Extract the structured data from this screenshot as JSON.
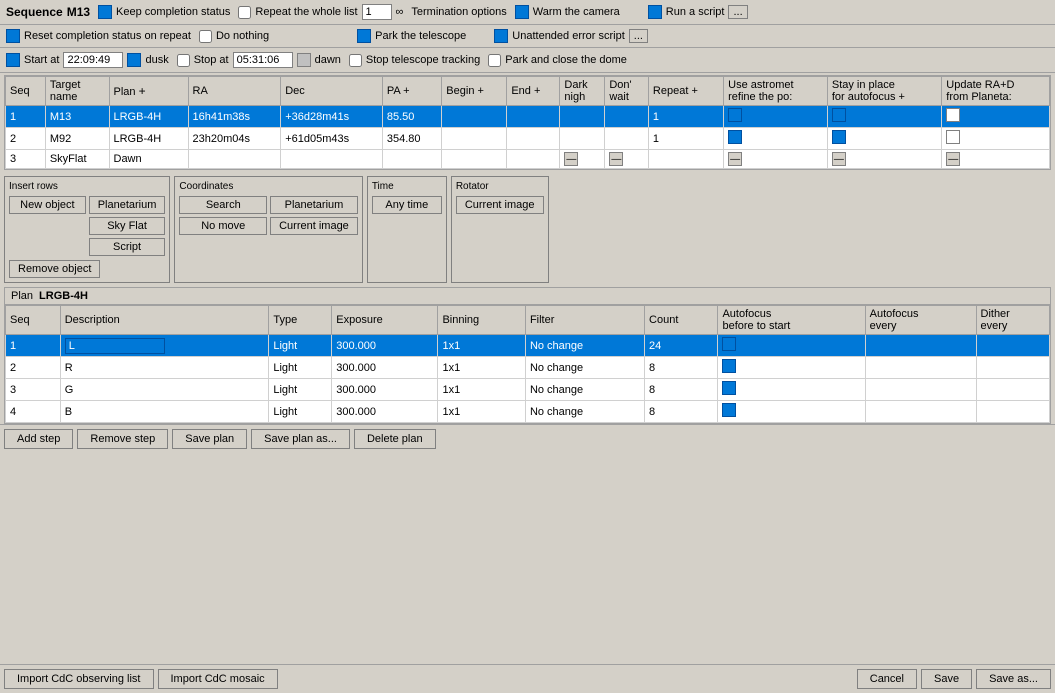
{
  "sequence": {
    "label": "Sequence",
    "name": "M13",
    "repeat_label": "Repeat the whole list",
    "repeat_value": "1",
    "keep_completion_label": "Keep completion status",
    "reset_completion_label": "Reset completion status on repeat",
    "start_at_label": "Start at",
    "start_time": "22:09:49",
    "dusk_label": "dusk",
    "stop_at_label": "Stop at",
    "stop_time": "05:31:06",
    "dawn_label": "dawn"
  },
  "termination": {
    "label": "Termination options",
    "do_nothing": "Do nothing",
    "stop_tracking": "Stop telescope tracking",
    "warm_camera": "Warm the camera",
    "park_telescope": "Park the telescope",
    "park_close_dome": "Park and close the dome",
    "run_script": "Run a script",
    "unattended_error": "Unattended error script"
  },
  "seq_table": {
    "headers": [
      "Seq",
      "Target name",
      "Plan",
      "",
      "RA",
      "Dec",
      "PA",
      "",
      "Begin",
      "",
      "End",
      "",
      "Dark nigh",
      "Don' wait",
      "Repeat",
      "",
      "Use astromet refine the po:",
      "Stay in place for autofocus",
      "",
      "Update RA+D from Planeta:"
    ],
    "rows": [
      {
        "seq": "1",
        "target": "M13",
        "plan": "LRGB-4H",
        "ra": "16h41m38s",
        "dec": "+36d28m41s",
        "pa": "85.50",
        "begin": "",
        "end": "",
        "dark": "",
        "dont_wait": "",
        "repeat": "1",
        "use_astro": "blue",
        "stay_place": "blue",
        "update_ra": "unchecked",
        "selected": true
      },
      {
        "seq": "2",
        "target": "M92",
        "plan": "LRGB-4H",
        "ra": "23h20m04s",
        "dec": "+61d05m43s",
        "pa": "354.80",
        "begin": "",
        "end": "",
        "dark": "",
        "dont_wait": "",
        "repeat": "1",
        "use_astro": "blue",
        "stay_place": "blue",
        "update_ra": "unchecked",
        "selected": false
      },
      {
        "seq": "3",
        "target": "SkyFlat",
        "plan": "Dawn",
        "ra": "",
        "dec": "",
        "pa": "",
        "begin": "",
        "end": "",
        "dark": "minus",
        "dont_wait": "minus",
        "repeat": "",
        "use_astro": "minus",
        "stay_place": "minus",
        "update_ra": "minus",
        "selected": false
      }
    ]
  },
  "insert_rows": {
    "title": "Insert rows",
    "new_object": "New object",
    "planetarium": "Planetarium",
    "sky_flat": "Sky Flat",
    "script": "Script",
    "remove_object": "Remove object"
  },
  "coordinates": {
    "title": "Coordinates",
    "search": "Search",
    "planetarium": "Planetarium",
    "no_move": "No move",
    "current_image": "Current image"
  },
  "time": {
    "title": "Time",
    "any_time": "Any time"
  },
  "rotator": {
    "title": "Rotator",
    "current_image": "Current image"
  },
  "plan": {
    "label": "Plan",
    "name": "LRGB-4H",
    "headers": [
      "Seq",
      "Description",
      "Type",
      "Exposure",
      "Binning",
      "Filter",
      "Count",
      "Autofocus before to start",
      "Autofocus every",
      "Dither every"
    ],
    "rows": [
      {
        "seq": "1",
        "desc": "L",
        "type": "Light",
        "exposure": "300.000",
        "binning": "1x1",
        "filter": "No change",
        "count": "24",
        "af_before": "blue",
        "af_every": "",
        "dither": "",
        "selected": true
      },
      {
        "seq": "2",
        "desc": "R",
        "type": "Light",
        "exposure": "300.000",
        "binning": "1x1",
        "filter": "No change",
        "count": "8",
        "af_before": "blue",
        "af_every": "",
        "dither": "",
        "selected": false
      },
      {
        "seq": "3",
        "desc": "G",
        "type": "Light",
        "exposure": "300.000",
        "binning": "1x1",
        "filter": "No change",
        "count": "8",
        "af_before": "blue",
        "af_every": "",
        "dither": "",
        "selected": false
      },
      {
        "seq": "4",
        "desc": "B",
        "type": "Light",
        "exposure": "300.000",
        "binning": "1x1",
        "filter": "No change",
        "count": "8",
        "af_before": "blue",
        "af_every": "",
        "dither": "",
        "selected": false
      }
    ]
  },
  "plan_buttons": {
    "add_step": "Add step",
    "remove_step": "Remove step",
    "save_plan": "Save plan",
    "save_plan_as": "Save plan as...",
    "delete_plan": "Delete plan"
  },
  "footer_buttons": {
    "import_cdc": "Import CdC observing list",
    "import_mosaic": "Import CdC mosaic",
    "cancel": "Cancel",
    "save": "Save",
    "save_as": "Save as..."
  }
}
